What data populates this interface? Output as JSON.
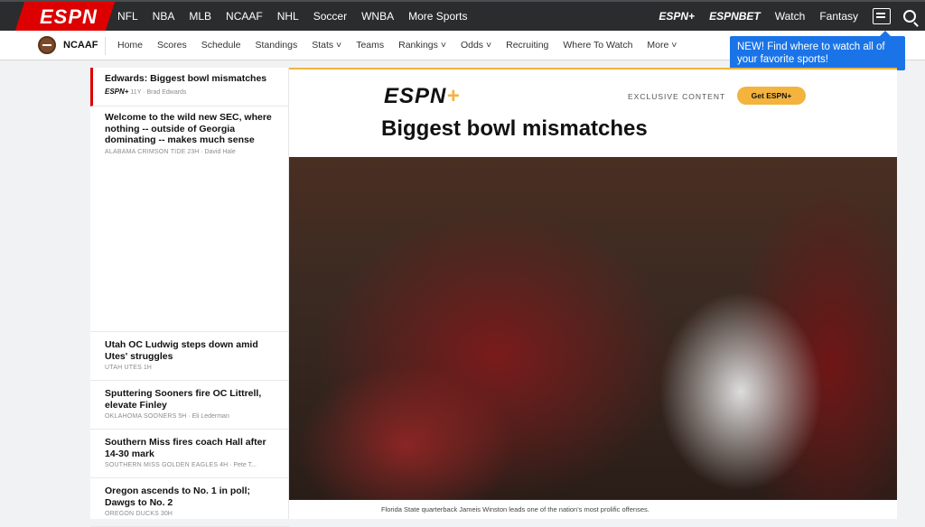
{
  "topbar": {
    "logo": "ESPN",
    "nav": [
      "NFL",
      "NBA",
      "MLB",
      "NCAAF",
      "NHL",
      "Soccer",
      "WNBA",
      "More Sports"
    ],
    "espn_plus": "ESPN+",
    "espn_bet": "ESPNBET",
    "watch": "Watch",
    "fantasy": "Fantasy"
  },
  "subnav": {
    "title": "NCAAF",
    "items": [
      "Home",
      "Scores",
      "Schedule",
      "Standings",
      "Stats ˅",
      "Teams",
      "Rankings ˅",
      "Odds ˅",
      "Recruiting",
      "Where To Watch",
      "More ˅"
    ]
  },
  "tooltip": "NEW! Find where to watch all of your favorite sports!",
  "sidebar": {
    "items": [
      {
        "title": "Edwards: Biggest bowl mismatches",
        "tag": "ESPN+",
        "time": "11y",
        "author": "Brad Edwards"
      },
      {
        "title": "Welcome to the wild new SEC, where nothing -- outside of Georgia dominating -- makes much sense",
        "tag": "ALABAMA CRIMSON TIDE",
        "time": "23h",
        "author": "David Hale"
      },
      {
        "title": "Utah OC Ludwig steps down amid Utes' struggles",
        "tag": "UTAH UTES",
        "time": "1h",
        "author": ""
      },
      {
        "title": "Sputtering Sooners fire OC Littrell, elevate Finley",
        "tag": "OKLAHOMA SOONERS",
        "time": "5h",
        "author": "Eli Lederman"
      },
      {
        "title": "Southern Miss fires coach Hall after 14-30 mark",
        "tag": "SOUTHERN MISS GOLDEN EAGLES",
        "time": "4h",
        "author": "Pete T..."
      },
      {
        "title": "Oregon ascends to No. 1 in poll; Dawgs to No. 2",
        "tag": "OREGON DUCKS",
        "time": "30h",
        "author": ""
      }
    ]
  },
  "main": {
    "brand": "ESPN",
    "brand_plus": "+",
    "exclusive": "EXCLUSIVE CONTENT",
    "cta": "Get ESPN+",
    "headline": "Biggest bowl mismatches",
    "caption": "Florida State quarterback Jameis Winston leads one of the nation's most prolific offenses."
  },
  "colors": {
    "accent": "#dd0000",
    "plus_gold": "#f3b33d",
    "tooltip_blue": "#1a74e8"
  },
  "icons": [
    "ball-icon",
    "inbox-icon",
    "search-icon"
  ]
}
